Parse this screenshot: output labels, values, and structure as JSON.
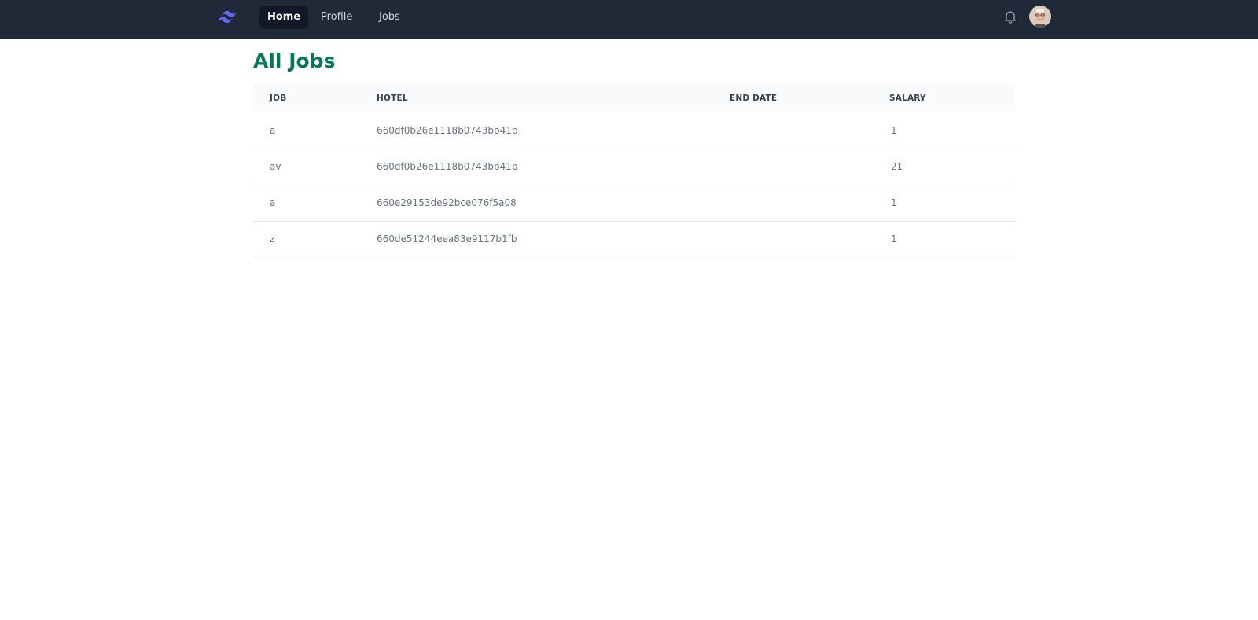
{
  "nav": {
    "items": [
      {
        "label": "Home",
        "active": true
      },
      {
        "label": "Profile",
        "active": false
      },
      {
        "label": "Jobs",
        "active": false
      }
    ],
    "logo_icon": "tailwind-wave-logo",
    "notification_icon": "bell-icon",
    "avatar": "user-avatar"
  },
  "page": {
    "title": "All Jobs"
  },
  "table": {
    "headers": {
      "job": "JOB",
      "hotel": "HOTEL",
      "end_date": "END DATE",
      "salary": "SALARY"
    },
    "rows": [
      {
        "job": "a",
        "hotel": "660df0b26e1118b0743bb41b",
        "end_date": "",
        "salary": "1"
      },
      {
        "job": "av",
        "hotel": "660df0b26e1118b0743bb41b",
        "end_date": "",
        "salary": "21"
      },
      {
        "job": "a",
        "hotel": "660e29153de92bce076f5a08",
        "end_date": "",
        "salary": "1"
      },
      {
        "job": "z",
        "hotel": "660de51244eea83e9117b1fb",
        "end_date": "",
        "salary": "1"
      }
    ]
  },
  "colors": {
    "nav_bg": "#1f2937",
    "title_green": "#047857",
    "logo_indigo": "#6366f1"
  }
}
